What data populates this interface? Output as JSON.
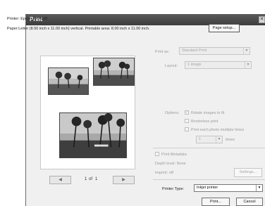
{
  "title": "Print",
  "close_label": "✕",
  "printer_line": "Printer: Epson AP-4000",
  "paper_line": "Paper:Letter (8.50 inch x 11.00 inch) vertical. Printable area: 8.00 inch x 11.00 inch.",
  "page_setup_label": "Page setup...",
  "print_as": {
    "label": "Print as:",
    "value": "Standard Print"
  },
  "layout": {
    "label": "Layout:",
    "value": "1 image"
  },
  "options": {
    "label": "Options:",
    "rotate": {
      "label": "Rotate images to fit",
      "checked": true
    },
    "borderless": {
      "label": "Borderless print",
      "checked": false
    },
    "multiple": {
      "label": "Print each photo multiple times",
      "checked": false
    },
    "times_value": "1",
    "times_label": "times"
  },
  "metadata": {
    "label": "Print Metadata",
    "depth": "Depth level: None",
    "imprint": "Imprint: off",
    "settings_label": "Settings..."
  },
  "pager": {
    "prev": "◀",
    "next": "▶",
    "current": "1",
    "of": "of",
    "total": "1"
  },
  "printer_type": {
    "label": "Printer Type:",
    "value": "Inkjet printer"
  },
  "buttons": {
    "print": "Print...",
    "cancel": "Cancel"
  }
}
